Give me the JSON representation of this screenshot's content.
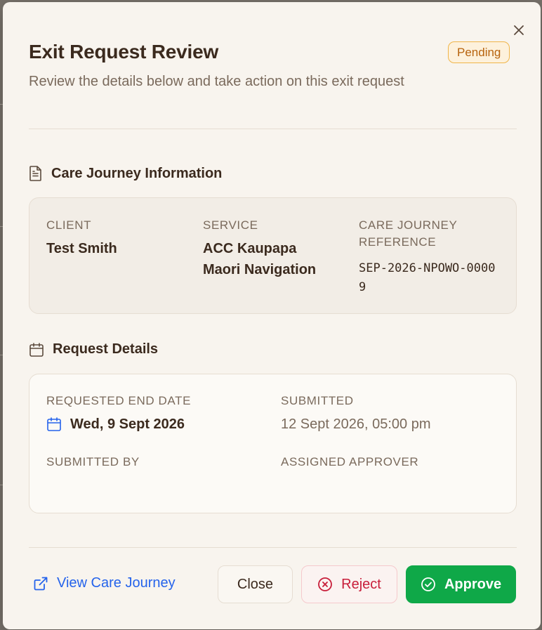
{
  "modal": {
    "title": "Exit Request Review",
    "status_badge": "Pending",
    "subtitle": "Review the details below and take action on this exit request"
  },
  "care_journey": {
    "heading": "Care Journey Information",
    "client_label": "CLIENT",
    "client_value": "Test Smith",
    "service_label": "SERVICE",
    "service_value": "ACC Kaupapa Maori Navigation",
    "reference_label": "CARE JOURNEY REFERENCE",
    "reference_value": "SEP-2026-NPOWO-00009"
  },
  "request_details": {
    "heading": "Request Details",
    "end_date_label": "REQUESTED END DATE",
    "end_date_value": "Wed, 9 Sept 2026",
    "submitted_label": "SUBMITTED",
    "submitted_value": "12 Sept 2026, 05:00 pm",
    "submitted_by_label": "SUBMITTED BY",
    "approver_label": "ASSIGNED APPROVER"
  },
  "footer": {
    "view_link": "View Care Journey",
    "close_label": "Close",
    "reject_label": "Reject",
    "approve_label": "Approve"
  },
  "icons": {
    "close": "close-icon",
    "document": "document-icon",
    "calendar": "calendar-icon",
    "external_link": "external-link-icon",
    "reject": "x-circle-icon",
    "approve": "check-circle-icon"
  },
  "colors": {
    "badge_border": "#f0b549",
    "badge_text": "#b7630d",
    "link": "#2563eb",
    "reject": "#c81e3a",
    "approve": "#0fa848"
  }
}
